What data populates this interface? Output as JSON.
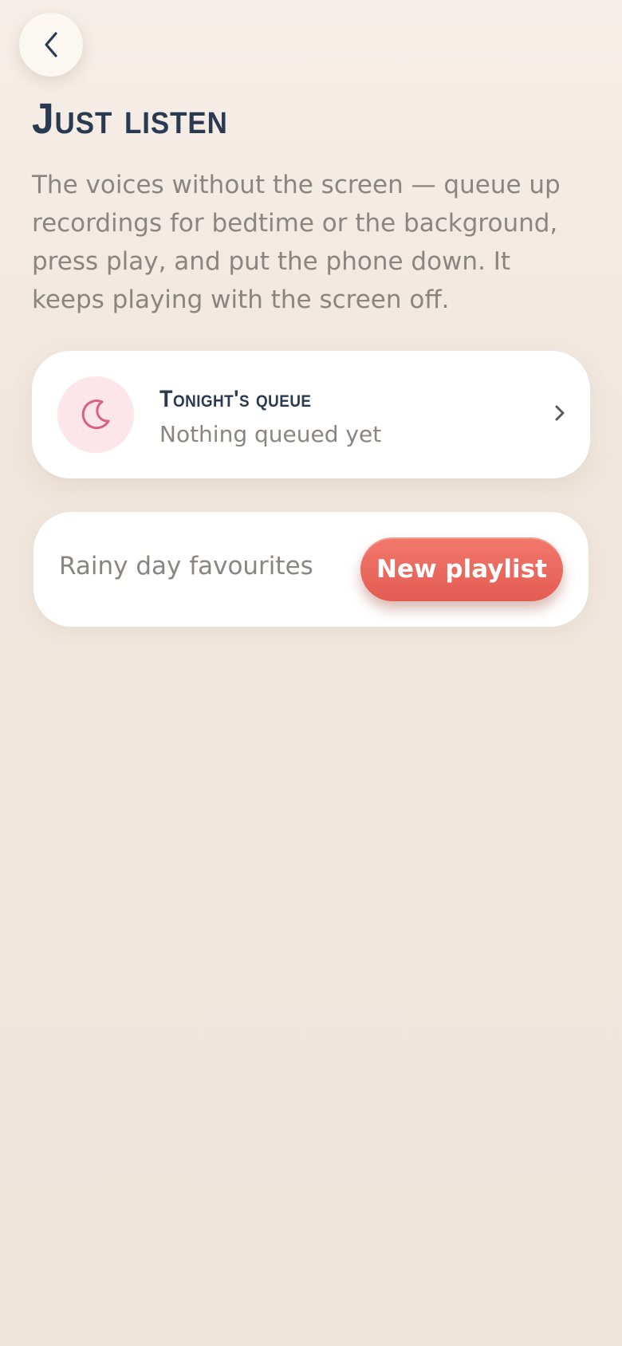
{
  "header": {
    "back_icon": "chevron-left-icon",
    "title": "Just listen",
    "intro": "The voices without the screen — queue up recordings for bedtime or the background, press play, and put the phone down. It keeps playing with the screen off."
  },
  "queue": {
    "icon": "moon-icon",
    "title": "Tonight's queue",
    "subtitle": "Nothing queued yet",
    "chevron_icon": "chevron-right-icon"
  },
  "playlist": {
    "input_value": "Rainy day favourites",
    "button_label": "New playlist"
  },
  "colors": {
    "title": "#2a3a50",
    "muted_text": "#8a8580",
    "accent": "#e8665b",
    "moon": "#d9607e",
    "moon_bg": "#fde6ea",
    "background": "#efe5db"
  }
}
